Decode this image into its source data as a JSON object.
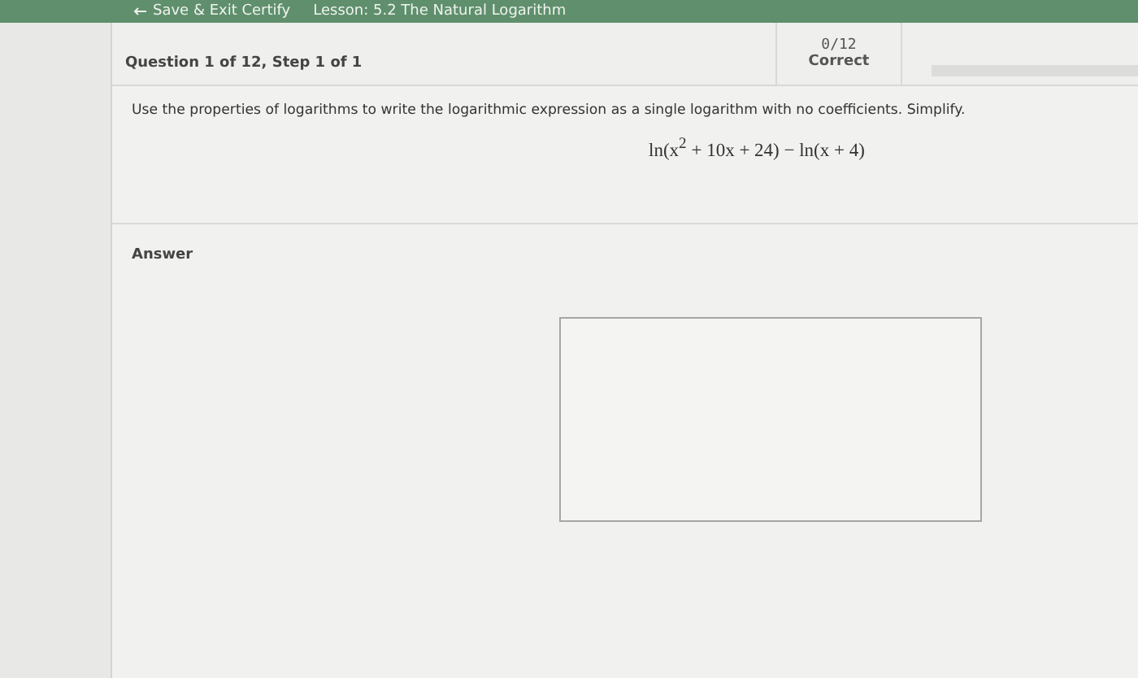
{
  "top_bar": {
    "exit_link": "Save & Exit Certify",
    "lesson": "Lesson: 5.2 The Natural Logarithm"
  },
  "header": {
    "question": "Question 1 of 12, Step 1 of 1",
    "score": "0/12",
    "score_label": "Correct",
    "progress": {
      "level": 0
    }
  },
  "prompt": "Use the properties of logarithms to write the logarithmic expression as a single logarithm with no coefficients. Simplify.",
  "expression": "ln(x$^{2}$ + 10x + 24) − ln(x + 4)",
  "answer": {
    "label": "Answer"
  }
}
